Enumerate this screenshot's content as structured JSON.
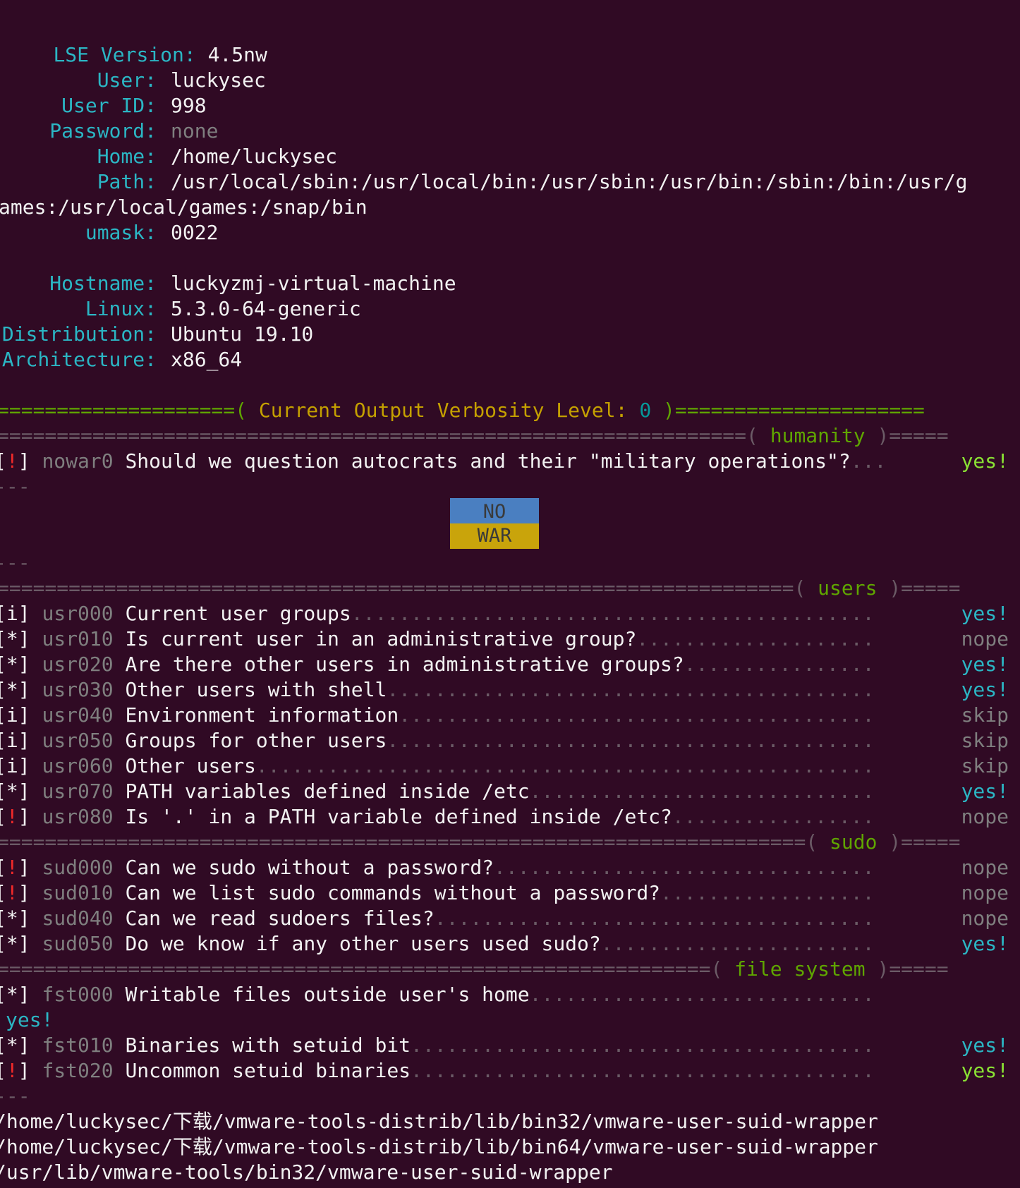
{
  "info": {
    "version_label": "LSE Version:",
    "version_value": "4.5nw",
    "fields": [
      {
        "label": "User:",
        "value": "luckysec"
      },
      {
        "label": "User ID:",
        "value": "998"
      },
      {
        "label": "Password:",
        "value": "none"
      },
      {
        "label": "Home:",
        "value": "/home/luckysec"
      },
      {
        "label": "Path:",
        "value": "/usr/local/sbin:/usr/local/bin:/usr/sbin:/usr/bin:/sbin:/bin:/usr/g"
      },
      {
        "label": "",
        "value": "ames:/usr/local/games:/snap/bin"
      },
      {
        "label": "umask:",
        "value": "0022"
      }
    ],
    "host_fields": [
      {
        "label": "Hostname:",
        "value": "luckyzmj-virtual-machine"
      },
      {
        "label": "Linux:",
        "value": "5.3.0-64-generic"
      },
      {
        "label": "Distribution:",
        "value": "Ubuntu 19.10"
      },
      {
        "label": "Architecture:",
        "value": "x86_64"
      }
    ]
  },
  "verbosity": {
    "left_rule": "====================(",
    "text": " Current Output Verbosity Level: ",
    "level": "0",
    "right_rule": " )====================="
  },
  "sections": {
    "humanity": {
      "rule": "===============================================================(",
      "name": " humanity ",
      "end": ")====="
    },
    "users": {
      "rule": "===================================================================(",
      "name": " users ",
      "end": ")====="
    },
    "sudo": {
      "rule": "====================================================================(",
      "name": " sudo ",
      "end": ")====="
    },
    "file_system": {
      "rule": "============================================================(",
      "name": " file system ",
      "end": ")====="
    }
  },
  "humanity_check": {
    "bracket": "[!]",
    "id": "nowar0",
    "text": "Should we question autocrats and their \"military operations\"?",
    "dots": "...",
    "result": "yes!"
  },
  "separator": "---",
  "flag": {
    "top": "NO",
    "bottom": "WAR"
  },
  "user_checks": [
    {
      "bracket": "i",
      "id": "usr000",
      "text": "Current user groups",
      "result": "yes!",
      "rclass": "cyan"
    },
    {
      "bracket": "*",
      "id": "usr010",
      "text": "Is current user in an administrative group?",
      "result": "nope",
      "rclass": "gray"
    },
    {
      "bracket": "*",
      "id": "usr020",
      "text": "Are there other users in administrative groups?",
      "result": "yes!",
      "rclass": "cyan"
    },
    {
      "bracket": "*",
      "id": "usr030",
      "text": "Other users with shell",
      "result": "yes!",
      "rclass": "cyan"
    },
    {
      "bracket": "i",
      "id": "usr040",
      "text": "Environment information",
      "result": "skip",
      "rclass": "gray"
    },
    {
      "bracket": "i",
      "id": "usr050",
      "text": "Groups for other users",
      "result": "skip",
      "rclass": "gray"
    },
    {
      "bracket": "i",
      "id": "usr060",
      "text": "Other users",
      "result": "skip",
      "rclass": "gray"
    },
    {
      "bracket": "*",
      "id": "usr070",
      "text": "PATH variables defined inside /etc",
      "result": "yes!",
      "rclass": "cyan"
    },
    {
      "bracket": "!",
      "id": "usr080",
      "text": "Is '.' in a PATH variable defined inside /etc?",
      "result": "nope",
      "rclass": "gray"
    }
  ],
  "sudo_checks": [
    {
      "bracket": "!",
      "id": "sud000",
      "text": "Can we sudo without a password?",
      "result": "nope",
      "rclass": "gray"
    },
    {
      "bracket": "!",
      "id": "sud010",
      "text": "Can we list sudo commands without a password?",
      "result": "nope",
      "rclass": "gray"
    },
    {
      "bracket": "*",
      "id": "sud040",
      "text": "Can we read sudoers files?",
      "result": "nope",
      "rclass": "gray"
    },
    {
      "bracket": "*",
      "id": "sud050",
      "text": "Do we know if any other users used sudo?",
      "result": "yes!",
      "rclass": "cyan"
    }
  ],
  "fs_checks": [
    {
      "bracket": "*",
      "id": "fst000",
      "text": "Writable files outside user's home",
      "result": "",
      "rclass": "cyan"
    },
    {
      "bracket": "*",
      "id": "fst010",
      "text": "Binaries with setuid bit",
      "result": "yes!",
      "rclass": "cyan"
    },
    {
      "bracket": "!",
      "id": "fst020",
      "text": "Uncommon setuid binaries",
      "result": "yes!",
      "rclass": "grn"
    }
  ],
  "fst000_wrapped_result": "yes!",
  "paths": [
    "/home/luckysec/下载/vmware-tools-distrib/lib/bin32/vmware-user-suid-wrapper",
    "/home/luckysec/下载/vmware-tools-distrib/lib/bin64/vmware-user-suid-wrapper",
    "/usr/lib/vmware-tools/bin32/vmware-user-suid-wrapper"
  ]
}
